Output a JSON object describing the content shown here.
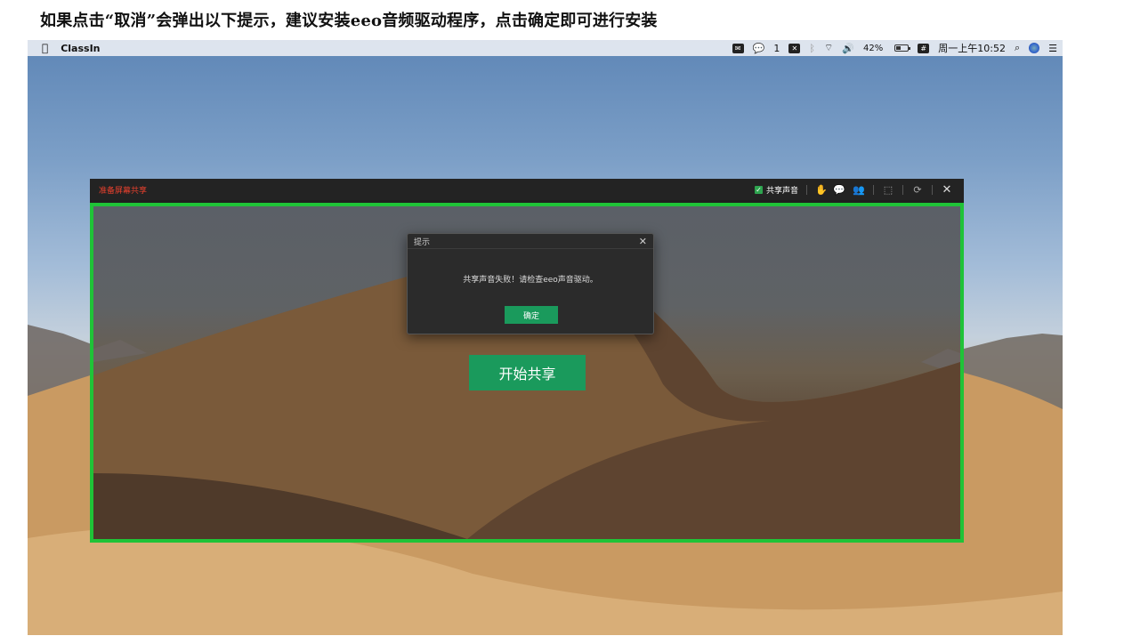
{
  "caption": "如果点击“取消”会弹出以下提示，建议安装eeo音频驱动程序，点击确定即可进行安装",
  "menubar": {
    "app_name": "ClassIn",
    "wechat_badge": "1",
    "battery_label": "42%",
    "battery_level": 0.42,
    "clock": "周一上午10:52"
  },
  "share_window": {
    "title": "准备屏幕共享",
    "share_audio_label": "共享声音",
    "share_audio_checked": true,
    "start_button": "开始共享"
  },
  "dialog": {
    "title": "提示",
    "message": "共享声音失败！请检查eeo声音驱动。",
    "ok_label": "确定"
  },
  "colors": {
    "accent_green": "#1a9a5c",
    "highlight_border": "#1fc337",
    "title_red": "#e8402d"
  }
}
